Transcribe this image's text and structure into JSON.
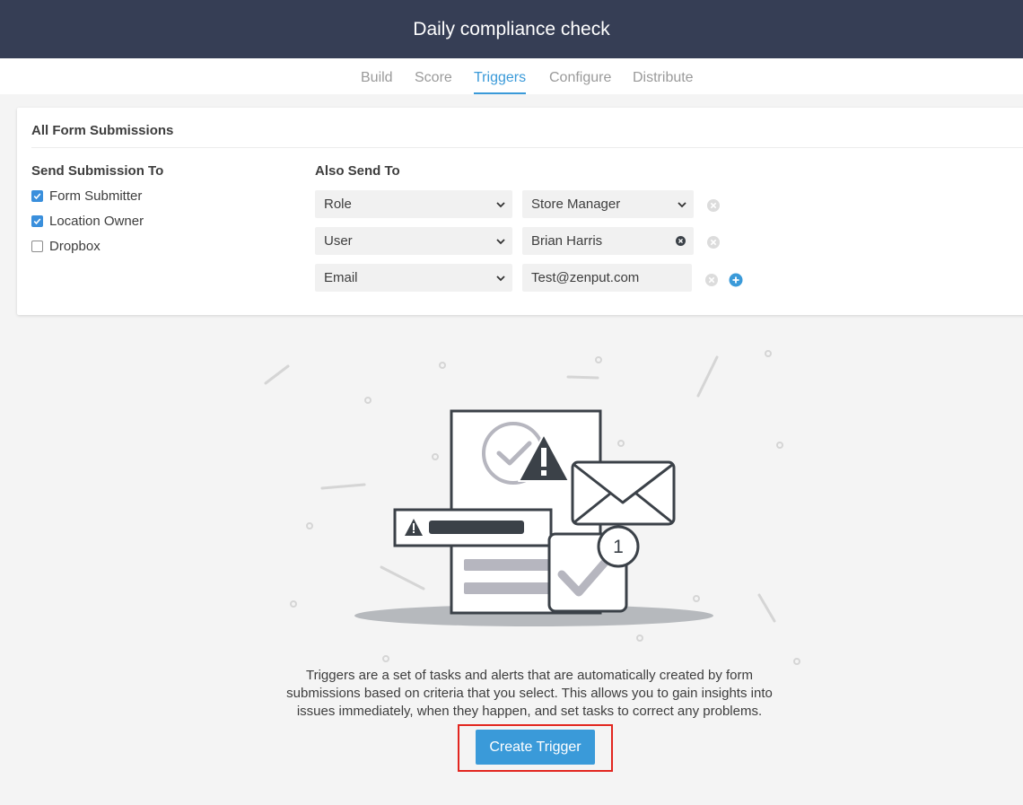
{
  "header": {
    "title": "Daily compliance check"
  },
  "tabs": [
    {
      "label": "Build",
      "active": false
    },
    {
      "label": "Score",
      "active": false
    },
    {
      "label": "Triggers",
      "active": true
    },
    {
      "label": "Configure",
      "active": false
    },
    {
      "label": "Distribute",
      "active": false
    }
  ],
  "card": {
    "title": "All Form Submissions",
    "send_to": {
      "label": "Send Submission To",
      "options": [
        {
          "label": "Form Submitter",
          "checked": true
        },
        {
          "label": "Location Owner",
          "checked": true
        },
        {
          "label": "Dropbox",
          "checked": false
        }
      ]
    },
    "also_send": {
      "label": "Also Send To",
      "rows": [
        {
          "type": "Role",
          "value": "Store Manager",
          "value_kind": "select"
        },
        {
          "type": "User",
          "value": "Brian Harris",
          "value_kind": "clearable"
        },
        {
          "type": "Email",
          "value": "Test@zenput.com",
          "value_kind": "text"
        }
      ]
    }
  },
  "empty_state": {
    "description_lines": [
      "Triggers are a set of tasks and alerts that are automatically created by form",
      "submissions based on criteria that you select. This allows you to gain insights into",
      "issues immediately, when they happen, and set tasks to correct any problems."
    ],
    "badge_count": "1",
    "button_label": "Create Trigger"
  },
  "colors": {
    "header_bg": "#363e55",
    "accent": "#3a9ad9",
    "highlight": "#e2261f",
    "icon_dark": "#3b4148",
    "icon_gray": "#b6b6bf"
  }
}
